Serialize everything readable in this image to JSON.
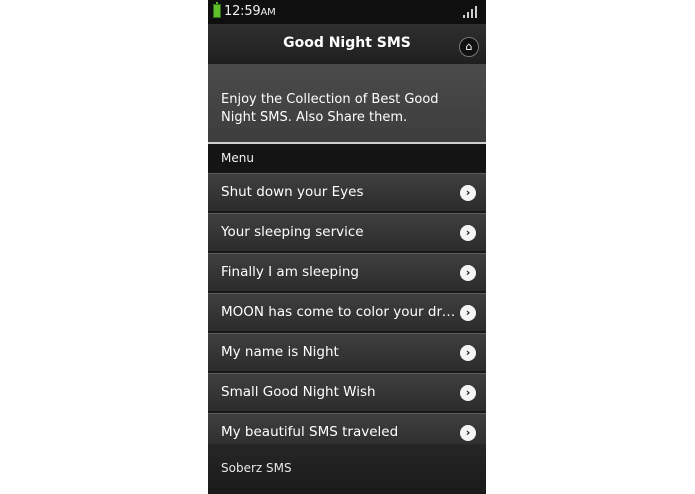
{
  "status_bar": {
    "time": "12:59",
    "ampm": "AM",
    "battery_color": "#5fbf2b"
  },
  "header": {
    "title": "Good Night SMS",
    "home_icon": "home-icon"
  },
  "intro": {
    "text": "Enjoy the Collection of Best Good Night SMS. Also Share them."
  },
  "menu": {
    "header": "Menu",
    "items": [
      {
        "label": "Shut down your Eyes"
      },
      {
        "label": "Your sleeping service"
      },
      {
        "label": "Finally I am sleeping"
      },
      {
        "label": "MOON has come to color your dre..."
      },
      {
        "label": "My name is Night"
      },
      {
        "label": "Small Good Night Wish"
      },
      {
        "label": "My beautiful SMS traveled"
      }
    ],
    "arrow_icon": "chevron-right-icon"
  },
  "footer": {
    "text": "Soberz SMS"
  }
}
